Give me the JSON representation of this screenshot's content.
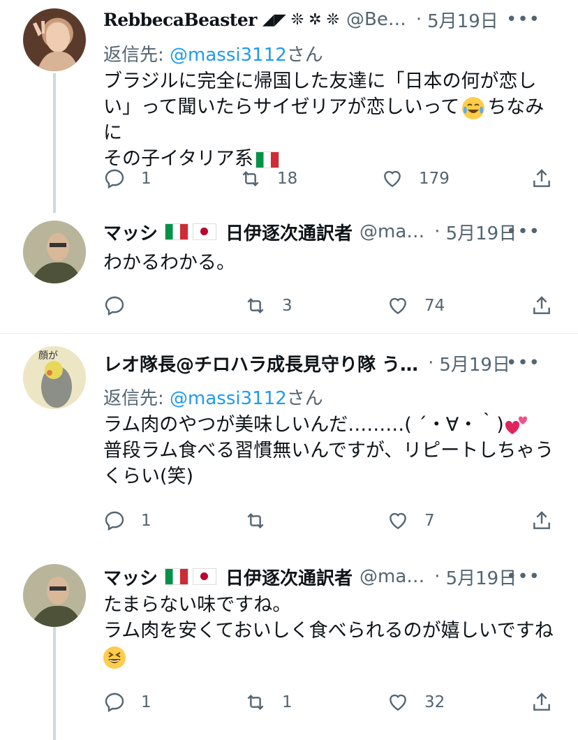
{
  "tweets": [
    {
      "name": "RebbecaBeaster",
      "name_symbols": "◢◤ ❊ ✲ ❊",
      "handle": "@Be…",
      "date": "5月19日",
      "reply_prefix": "返信先: ",
      "reply_mention": "@massi3112",
      "reply_suffix": "さん",
      "body_lines": [
        "ブラジルに完全に帰国した友達に「日本の何が恋し",
        "い」って聞いたらサイゼリアが恋しいって",
        "ちなみに",
        "その子イタリア系"
      ],
      "replies": "1",
      "retweets": "18",
      "likes": "179"
    },
    {
      "name": "マッシ",
      "name_suffix": "日伊逐次通訳者",
      "handle": "@ma…",
      "date": "5月19日",
      "body_lines": [
        "わかるわかる。"
      ],
      "replies": "",
      "retweets": "3",
      "likes": "74"
    },
    {
      "name": "レオ隊長@チロハラ成長見守り隊 う…",
      "handle": "",
      "date": "5月19日",
      "reply_prefix": "返信先: ",
      "reply_mention": "@massi3112",
      "reply_suffix": "さん",
      "body_lines": [
        "ラム肉のやつが美味しいんだ………( ´・∀・｀)",
        "普段ラム食べる習慣無いんですが、リピートしちゃう",
        "くらい(笑)"
      ],
      "replies": "1",
      "retweets": "",
      "likes": "7"
    },
    {
      "name": "マッシ",
      "name_suffix": "日伊逐次通訳者",
      "handle": "@ma…",
      "date": "5月19日",
      "body_lines": [
        "たまらない味ですね。",
        "ラム肉を安くておいしく食べられるのが嬉しいですね"
      ],
      "replies": "1",
      "retweets": "1",
      "likes": "32"
    }
  ],
  "more_label": "•••",
  "dot_separator": "·",
  "colors": {
    "text": "#0f1419",
    "secondary": "#536471",
    "link": "#1d9bf0",
    "line": "#cfd9de"
  }
}
